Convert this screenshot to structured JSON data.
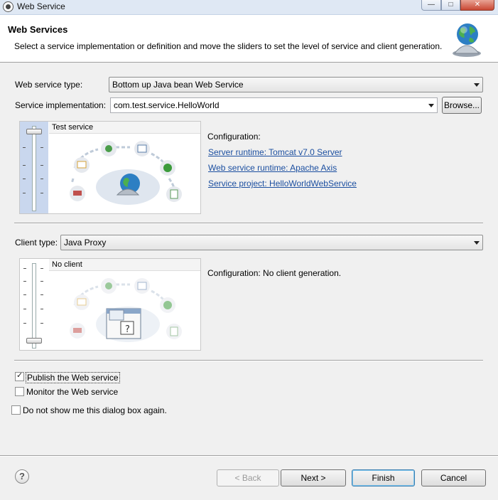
{
  "window": {
    "title": "Web Service",
    "min": "—",
    "max": "□",
    "close": "✕"
  },
  "header": {
    "title": "Web Services",
    "description": "Select a service implementation or definition and move the sliders to set the level of service and client generation."
  },
  "service": {
    "type_label": "Web service type:",
    "type_value": "Bottom up Java bean Web Service",
    "impl_label": "Service implementation:",
    "impl_value": "com.test.service.HelloWorld",
    "browse_label": "Browse...",
    "slider_level": "Test service",
    "config_label": "Configuration:",
    "links": [
      "Server runtime: Tomcat v7.0 Server",
      "Web service runtime: Apache Axis",
      "Service project: HelloWorldWebService"
    ]
  },
  "client": {
    "type_label": "Client type:",
    "type_value": "Java Proxy",
    "slider_level": "No client",
    "config_text": "Configuration: No client generation."
  },
  "options": {
    "publish": {
      "label": "Publish the Web service",
      "checked": true
    },
    "monitor": {
      "label": "Monitor the Web service",
      "checked": false
    },
    "dont_show": {
      "label": "Do not show me this dialog box again.",
      "checked": false
    }
  },
  "footer": {
    "help": "?",
    "back": "< Back",
    "next": "Next >",
    "finish": "Finish",
    "cancel": "Cancel"
  },
  "colors": {
    "link": "#1c4fa0",
    "slider_track": "#c9d7ee",
    "title_bar": "#dfe8f4"
  }
}
